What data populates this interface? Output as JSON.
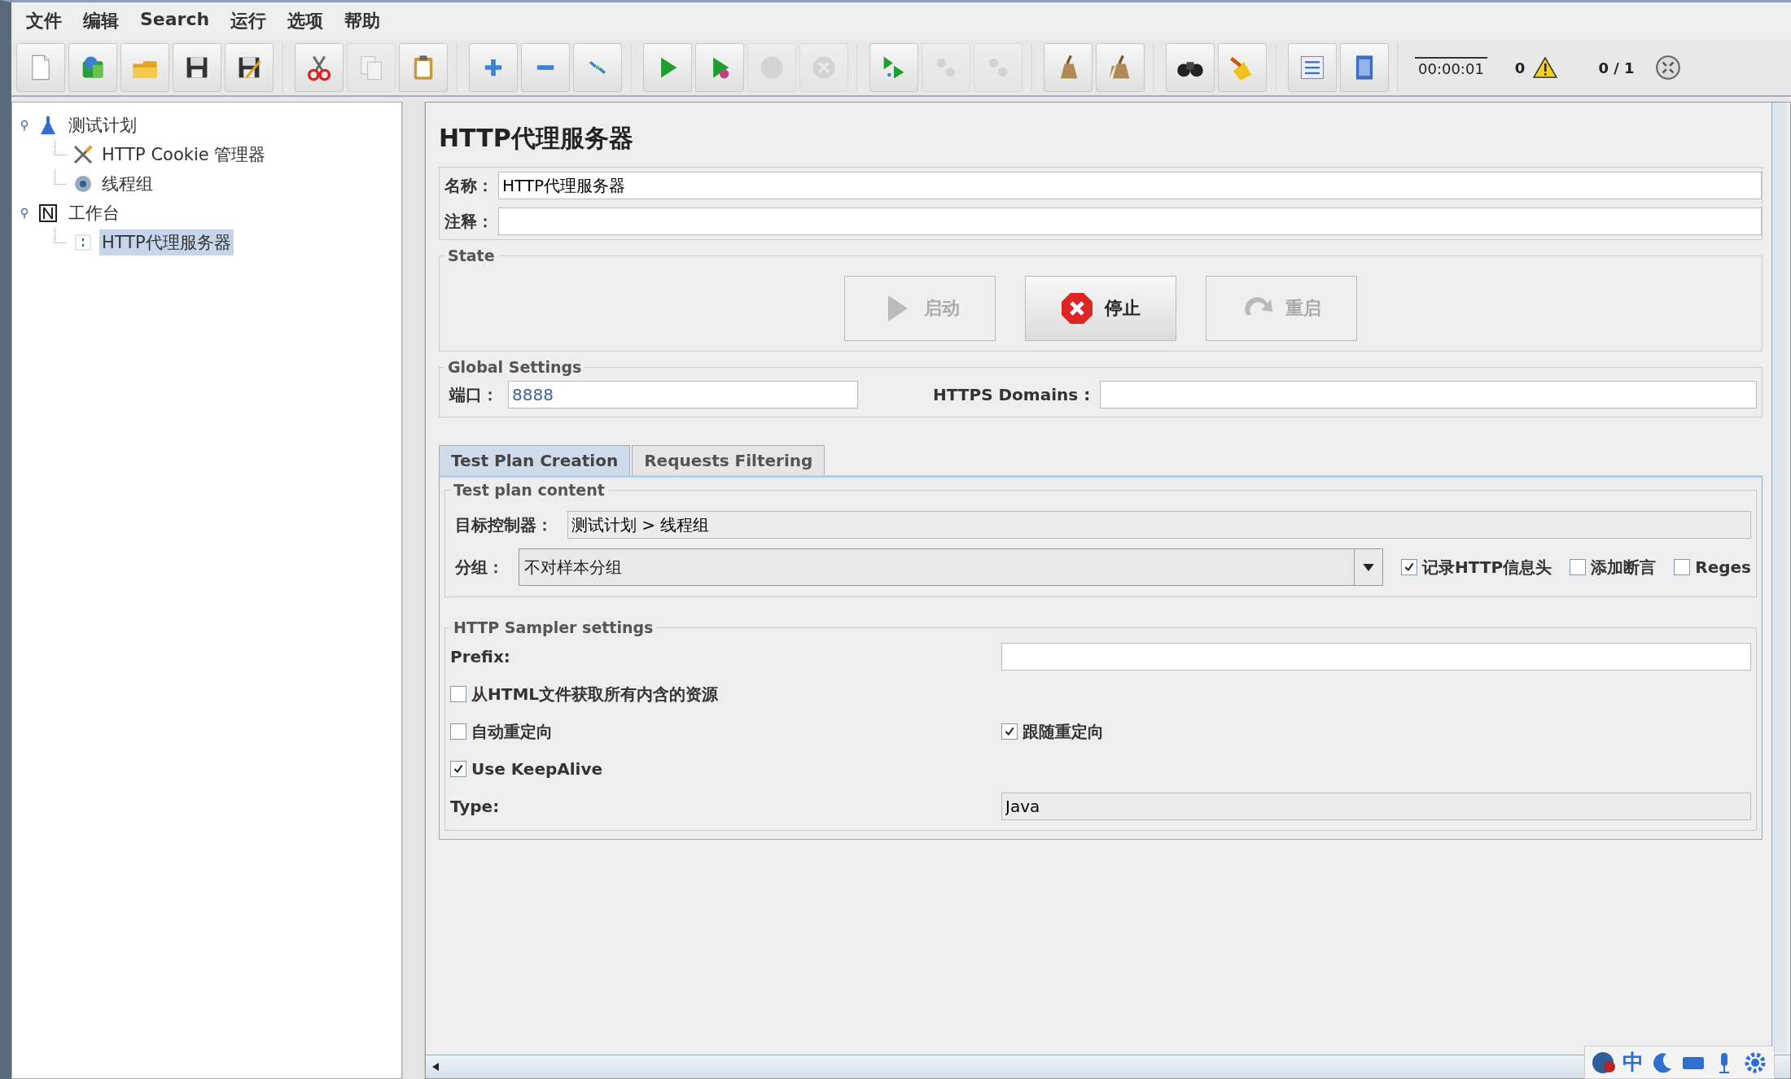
{
  "menu": [
    "文件",
    "编辑",
    "Search",
    "运行",
    "选项",
    "帮助"
  ],
  "toolbar": [
    {
      "buttons": [
        {
          "kind": "new",
          "disabled": false
        },
        {
          "kind": "templates",
          "disabled": false
        },
        {
          "kind": "open",
          "disabled": false
        },
        {
          "kind": "save",
          "disabled": false
        },
        {
          "kind": "saveas",
          "disabled": false
        }
      ]
    },
    {
      "buttons": [
        {
          "kind": "cut",
          "disabled": false
        },
        {
          "kind": "copy",
          "disabled": true
        },
        {
          "kind": "paste",
          "disabled": false
        }
      ]
    },
    {
      "buttons": [
        {
          "kind": "expand",
          "disabled": false
        },
        {
          "kind": "collapse",
          "disabled": false
        },
        {
          "kind": "toggle",
          "disabled": false
        }
      ]
    },
    {
      "buttons": [
        {
          "kind": "start",
          "disabled": false
        },
        {
          "kind": "startnp",
          "disabled": false
        },
        {
          "kind": "stop",
          "disabled": true
        },
        {
          "kind": "shutdown",
          "disabled": true
        }
      ]
    },
    {
      "buttons": [
        {
          "kind": "remotestart",
          "disabled": false
        },
        {
          "kind": "remotestop",
          "disabled": true
        },
        {
          "kind": "remoteexit",
          "disabled": true
        }
      ]
    },
    {
      "buttons": [
        {
          "kind": "clear",
          "disabled": false
        },
        {
          "kind": "clearall",
          "disabled": false
        }
      ]
    },
    {
      "buttons": [
        {
          "kind": "search",
          "disabled": false
        },
        {
          "kind": "reset",
          "disabled": false
        }
      ]
    },
    {
      "buttons": [
        {
          "kind": "functions",
          "disabled": false
        },
        {
          "kind": "help",
          "disabled": false
        }
      ]
    }
  ],
  "status": {
    "elapsed": "00:00:01",
    "errors": "0",
    "threads": "0 / 1"
  },
  "tree": [
    {
      "label": "测试计划",
      "kind": "plan",
      "expanded": true,
      "selected": false,
      "children": [
        {
          "label": "HTTP Cookie 管理器",
          "kind": "tools",
          "selected": false
        },
        {
          "label": "线程组",
          "kind": "gear",
          "selected": false
        }
      ]
    },
    {
      "label": "工作台",
      "kind": "workbench",
      "expanded": true,
      "selected": false,
      "children": [
        {
          "label": "HTTP代理服务器",
          "kind": "proxy",
          "selected": true
        }
      ]
    }
  ],
  "panel": {
    "title": "HTTP代理服务器",
    "name_label": "名称：",
    "name_value": "HTTP代理服务器",
    "comment_label": "注释：",
    "state": {
      "legend": "State",
      "buttons": [
        {
          "label": "启动",
          "kind": "start",
          "disabled": true
        },
        {
          "label": "停止",
          "kind": "stop",
          "disabled": false
        },
        {
          "label": "重启",
          "kind": "restart",
          "disabled": true
        }
      ]
    },
    "global": {
      "legend": "Global Settings",
      "port_label": "端口：",
      "port_value": "8888",
      "https_label": "HTTPS Domains :"
    },
    "tabs": [
      {
        "label": "Test Plan Creation",
        "selected": true
      },
      {
        "label": "Requests Filtering",
        "selected": false
      }
    ],
    "content": {
      "legend": "Test plan content",
      "target_label": "目标控制器：",
      "target_value": "测试计划 > 线程组",
      "grouping_label": "分组：",
      "grouping_value": "不对样本分组",
      "checks": [
        {
          "label": "记录HTTP信息头",
          "checked": true
        },
        {
          "label": "添加断言",
          "checked": false
        },
        {
          "label": "Reges",
          "checked": false
        }
      ]
    },
    "sampler": {
      "legend": "HTTP Sampler settings",
      "prefix_label": "Prefix:",
      "rows": [
        [
          {
            "label": "从HTML文件获取所有内含的资源",
            "checked": false
          }
        ],
        [
          {
            "label": "自动重定向",
            "checked": false
          },
          {
            "label": "跟随重定向",
            "checked": true
          }
        ],
        [
          {
            "label": "Use KeepAlive",
            "checked": true
          }
        ]
      ],
      "type_label": "Type:",
      "type_value": "Java"
    }
  },
  "ime": {
    "label": "中"
  }
}
